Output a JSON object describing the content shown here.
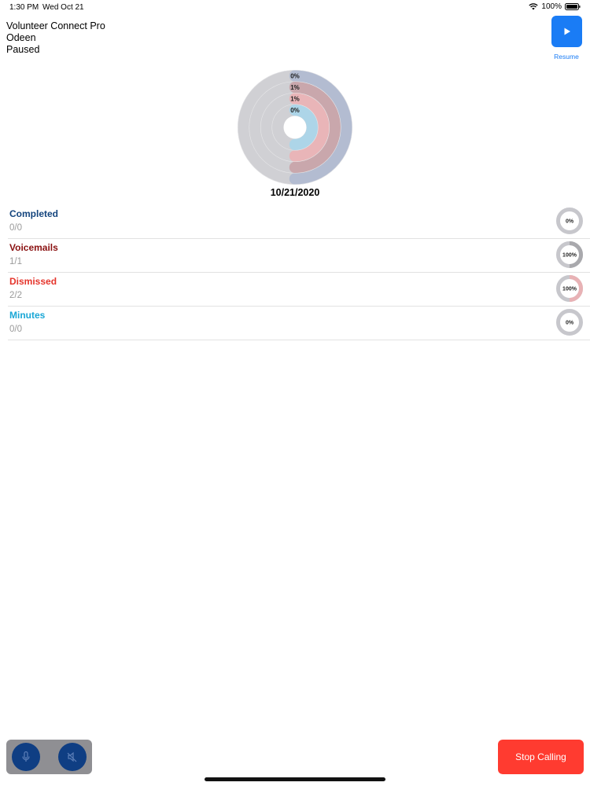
{
  "status_bar": {
    "time": "1:30 PM",
    "date": "Wed Oct 21",
    "battery": "100%"
  },
  "header": {
    "app_name": "Volunteer Connect Pro",
    "user": "Odeen",
    "state": "Paused"
  },
  "play_button": {
    "label": "Resume",
    "icon": "play-icon"
  },
  "radial_chart": {
    "rings": [
      {
        "label": "0%",
        "progress": 0.0,
        "color": "#b3bcd1",
        "name": "Completed"
      },
      {
        "label": "1%",
        "progress": 0.01,
        "color": "#c9a7ac",
        "name": "Voicemails"
      },
      {
        "label": "1%",
        "progress": 0.01,
        "color": "#e9b5b8",
        "name": "Dismissed"
      },
      {
        "label": "0%",
        "progress": 0.0,
        "color": "#add5e8",
        "name": "Minutes"
      }
    ],
    "visual_fill": [
      0.5,
      0.5,
      0.5,
      0.5
    ],
    "date": "10/21/2020"
  },
  "stats": [
    {
      "title": "Completed",
      "value": "0/0",
      "color": "#14457e",
      "ring_label": "0%",
      "progress": 0.0,
      "ring_color": "#c7c7cc",
      "fill_color": "#c7c7cc"
    },
    {
      "title": "Voicemails",
      "value": "1/1",
      "color": "#8a1111",
      "ring_label": "100%",
      "progress": 1.0,
      "ring_color": "#c7c7cc",
      "fill_color": "#a9a9ad"
    },
    {
      "title": "Dismissed",
      "value": "2/2",
      "color": "#e5352c",
      "ring_label": "100%",
      "progress": 1.0,
      "ring_color": "#c7c7cc",
      "fill_color": "#e8b2b5"
    },
    {
      "title": "Minutes",
      "value": "0/0",
      "color": "#1aa7d6",
      "ring_label": "0%",
      "progress": 0.0,
      "ring_color": "#c7c7cc",
      "fill_color": "#add5e8"
    }
  ],
  "controls": {
    "mic_icon": "microphone-icon",
    "speaker_icon": "speaker-muted-icon"
  },
  "stop_button": {
    "label": "Stop Calling"
  }
}
